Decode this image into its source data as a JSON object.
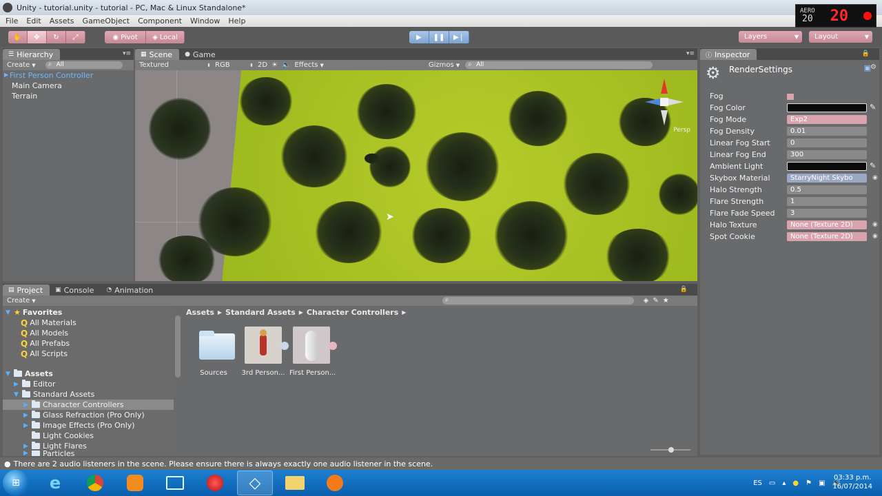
{
  "window": {
    "title": "Unity - tutorial.unity - tutorial - PC, Mac & Linux Standalone*"
  },
  "recorder": {
    "top_small": "AERO",
    "small_value": "20",
    "big_value": "20"
  },
  "menu": [
    "File",
    "Edit",
    "Assets",
    "GameObject",
    "Component",
    "Window",
    "Help"
  ],
  "toolbar": {
    "pivot_label": "Pivot",
    "local_label": "Local",
    "layers_label": "Layers",
    "layout_label": "Layout"
  },
  "hierarchy": {
    "tab": "Hierarchy",
    "create": "Create",
    "search": "All",
    "items": [
      "First Person Controller",
      "Main Camera",
      "Terrain"
    ]
  },
  "scene": {
    "tabs": [
      "Scene",
      "Game"
    ],
    "shading": "Textured",
    "render_mode": "RGB",
    "mode_2d": "2D",
    "effects": "Effects",
    "gizmos": "Gizmos",
    "search": "All",
    "persp_label": "Persp"
  },
  "inspector": {
    "tab": "Inspector",
    "component": "RenderSettings",
    "rows": [
      {
        "label": "Fog",
        "value": ""
      },
      {
        "label": "Fog Color",
        "value": ""
      },
      {
        "label": "Fog Mode",
        "value": "Exp2"
      },
      {
        "label": "Fog Density",
        "value": "0.01"
      },
      {
        "label": "Linear Fog Start",
        "value": "0"
      },
      {
        "label": "Linear Fog End",
        "value": "300"
      },
      {
        "label": "Ambient Light",
        "value": ""
      },
      {
        "label": "Skybox Material",
        "value": "StarryNight Skybo"
      },
      {
        "label": "Halo Strength",
        "value": "0.5"
      },
      {
        "label": "Flare Strength",
        "value": "1"
      },
      {
        "label": "Flare Fade Speed",
        "value": "3"
      },
      {
        "label": "Halo Texture",
        "value": "None (Texture 2D)"
      },
      {
        "label": "Spot Cookie",
        "value": "None (Texture 2D)"
      }
    ]
  },
  "project": {
    "tabs": [
      "Project",
      "Console",
      "Animation"
    ],
    "create": "Create",
    "favorites_label": "Favorites",
    "favorites": [
      "All Materials",
      "All Models",
      "All Prefabs",
      "All Scripts"
    ],
    "assets_label": "Assets",
    "assets_tree": [
      "Editor",
      "Standard Assets",
      "Character Controllers",
      "Glass Refraction (Pro Only)",
      "Image Effects (Pro Only)",
      "Light Cookies",
      "Light Flares",
      "Particles"
    ],
    "breadcrumb": [
      "Assets",
      "Standard Assets",
      "Character Controllers"
    ],
    "files": [
      "Sources",
      "3rd Person...",
      "First Person..."
    ]
  },
  "status": {
    "message": "There are 2 audio listeners in the scene. Please ensure there is always exactly one audio listener in the scene."
  },
  "taskbar": {
    "language": "ES",
    "time": "03:33 p.m.",
    "date": "16/07/2014"
  },
  "colors": {
    "accent_blue": "#6fb6ff",
    "panel_bg": "#696a6c",
    "terrain_green": "#a8c322",
    "taskbar_blue": "#0b5fad"
  }
}
